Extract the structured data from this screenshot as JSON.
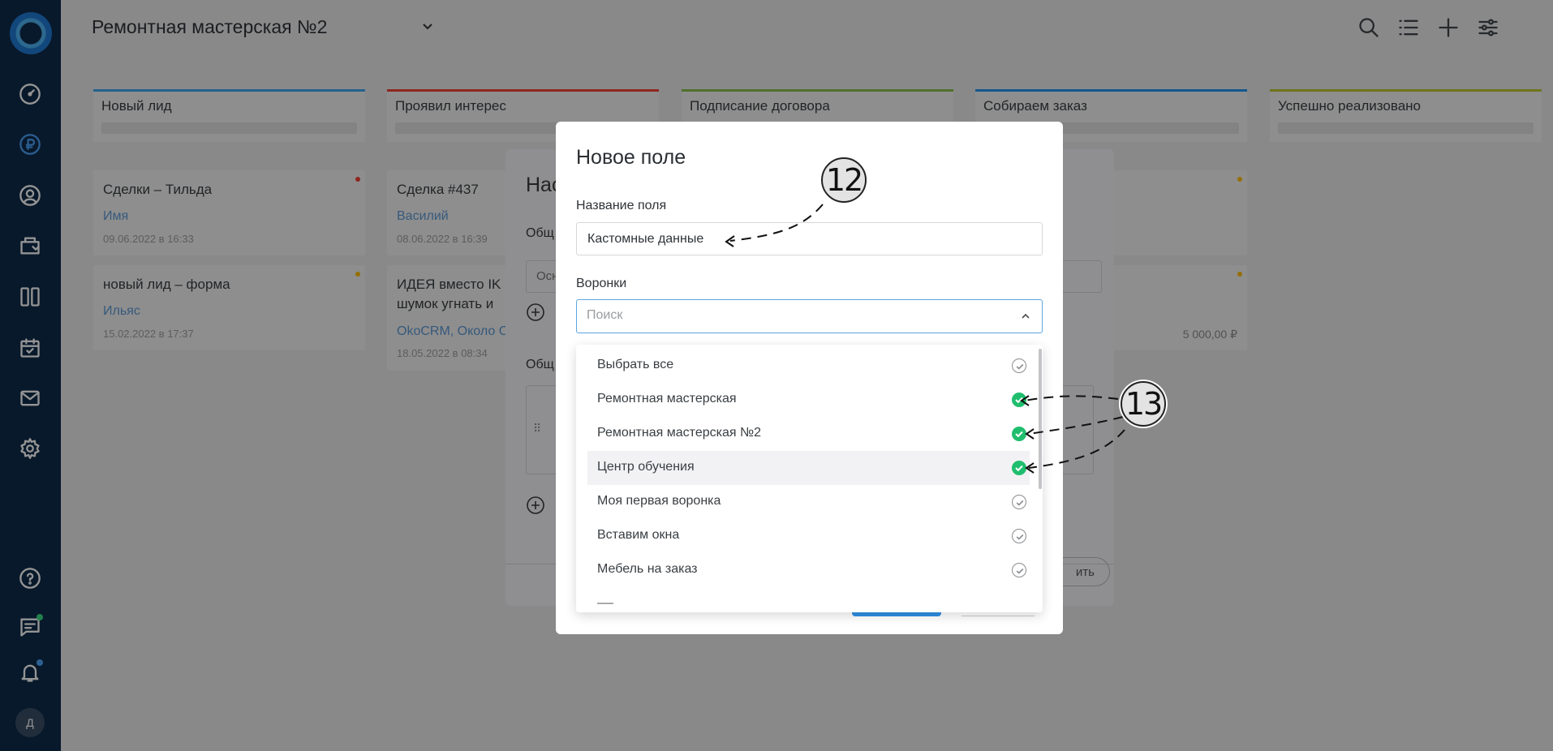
{
  "sidebar": {
    "avatar_letter": "Д",
    "icons": [
      "dashboard-icon",
      "ruble-icon",
      "user-circle-icon",
      "folder-icon",
      "kanban-icon",
      "calendar-check-icon",
      "mail-icon",
      "gear-icon",
      "help-icon",
      "chat-icon",
      "bell-icon"
    ]
  },
  "header": {
    "title": "Ремонтная мастерская №2",
    "icons": [
      "search-icon",
      "list-icon",
      "plus-icon",
      "filter-icon",
      "more-icon"
    ]
  },
  "columns": [
    {
      "title": "Новый лид",
      "color": "#3fa9f5"
    },
    {
      "title": "Проявил интерес",
      "color": "#f44336"
    },
    {
      "title": "Подписание договора",
      "color": "#8bc34a"
    },
    {
      "title": "Собираем заказ",
      "color": "#2196f3"
    },
    {
      "title": "Успешно реализовано",
      "color": "#c0ca33"
    }
  ],
  "cards": [
    {
      "title": "Сделки – Тильда",
      "name": "Имя",
      "date": "09.06.2022 в 16:33",
      "dot": "#f44336"
    },
    {
      "title": "новый лид – форма",
      "name": "Ильяс",
      "date": "15.02.2022 в 17:37",
      "dot": "#ffc107"
    },
    {
      "title": "Сделка #437",
      "name": "Василий",
      "date": "08.06.2022 в 16:39"
    },
    {
      "title": "ИДЕЯ вместо IK",
      "title2": "шумок угнать и",
      "name": "OkoCRM, Около С",
      "date": "18.05.2022 в 08:34"
    }
  ],
  "right_card": {
    "amount": "5 000,00 ₽"
  },
  "back_modal": {
    "title": "Нас",
    "label1": "Общ",
    "input_value": "Осн",
    "label2": "Общ",
    "handle": "⠿",
    "button": "ить"
  },
  "modal": {
    "title": "Новое поле",
    "field_label": "Название поля",
    "field_value": "Кастомные данные",
    "funnels_label": "Воронки",
    "search_placeholder": "Поиск"
  },
  "dropdown": {
    "items": [
      {
        "label": "Выбрать все",
        "checked": false
      },
      {
        "label": "Ремонтная мастерская",
        "checked": true
      },
      {
        "label": "Ремонтная мастерская №2",
        "checked": true
      },
      {
        "label": "Центр обучения",
        "checked": true
      },
      {
        "label": "Моя первая воронка",
        "checked": false
      },
      {
        "label": "Вставим окна",
        "checked": false
      },
      {
        "label": "Мебель на заказ",
        "checked": false
      }
    ]
  },
  "annotations": {
    "callout_12": "12",
    "callout_13": "13"
  }
}
